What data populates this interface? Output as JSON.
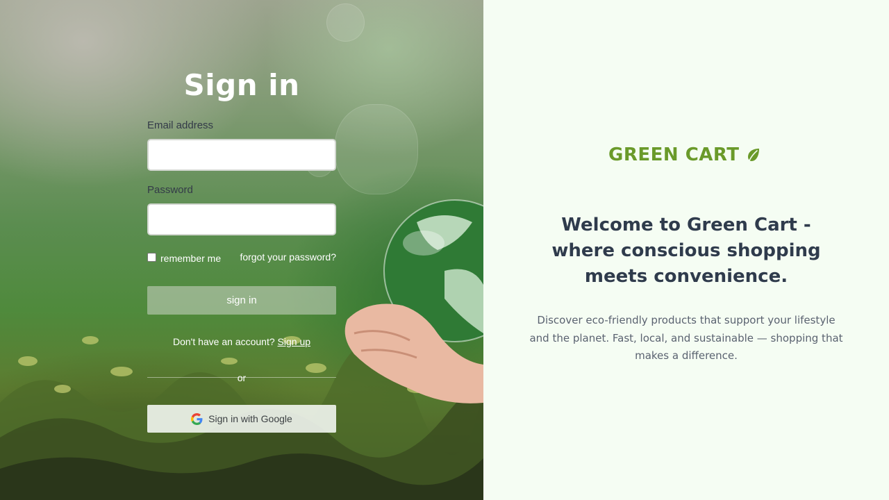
{
  "login": {
    "title": "Sign in",
    "email_label": "Email address",
    "email_value": "",
    "password_label": "Password",
    "password_value": "",
    "remember_label": "remember me",
    "remember_checked": false,
    "forgot_link": "forgot your password?",
    "submit_label": "sign in",
    "signup_prompt": "Don't have an account?",
    "signup_link": "Sign up",
    "divider_text": "or",
    "google_label": "Sign in with Google"
  },
  "brand": {
    "name": "GREEN CART",
    "icon": "leaf-icon",
    "color": "#6a9a2a"
  },
  "hero": {
    "welcome": "Welcome to Green Cart - where conscious shopping meets convenience.",
    "description": "Discover eco-friendly products that support your lifestyle and the planet. Fast, local, and sustainable — shopping that makes a difference."
  },
  "colors": {
    "panel_background": "#f5fdf3",
    "heading_text": "#2f3b4c",
    "body_text": "#5a6270"
  }
}
